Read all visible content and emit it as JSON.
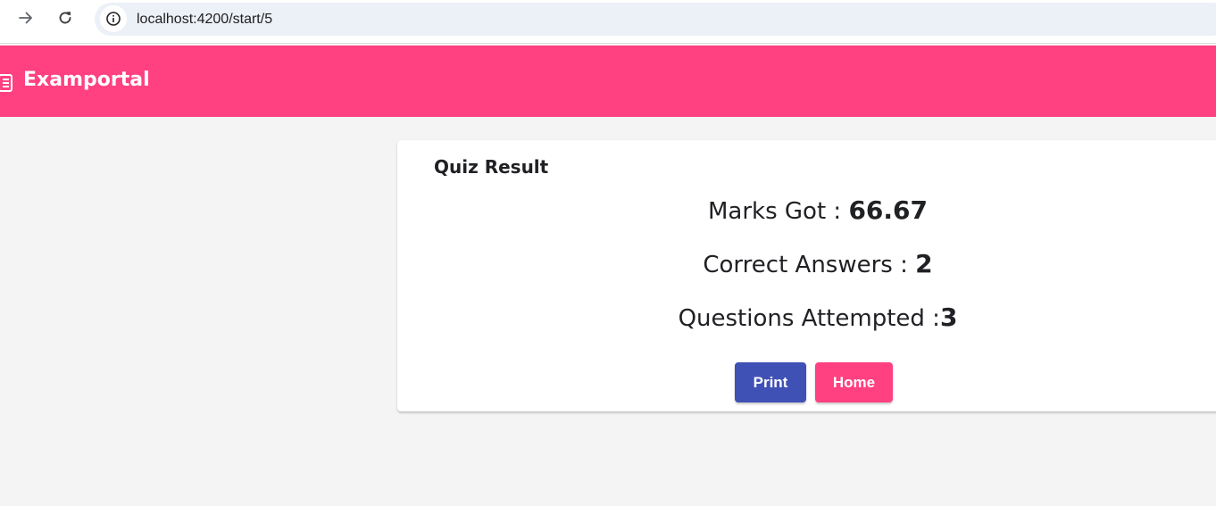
{
  "browser": {
    "url": "localhost:4200/start/5"
  },
  "toolbar": {
    "title": "Examportal",
    "icon": "book-icon",
    "color": "#ff4081"
  },
  "quiz_result": {
    "title": "Quiz Result",
    "marks_label": "Marks Got : ",
    "marks_value": "66.67",
    "correct_label": "Correct Answers : ",
    "correct_value": "2",
    "attempted_label": "Questions Attempted :",
    "attempted_value": "3",
    "print_label": "Print",
    "home_label": "Home"
  },
  "colors": {
    "primary": "#3f51b5",
    "accent": "#ff4081",
    "background": "#f4f4f4"
  }
}
